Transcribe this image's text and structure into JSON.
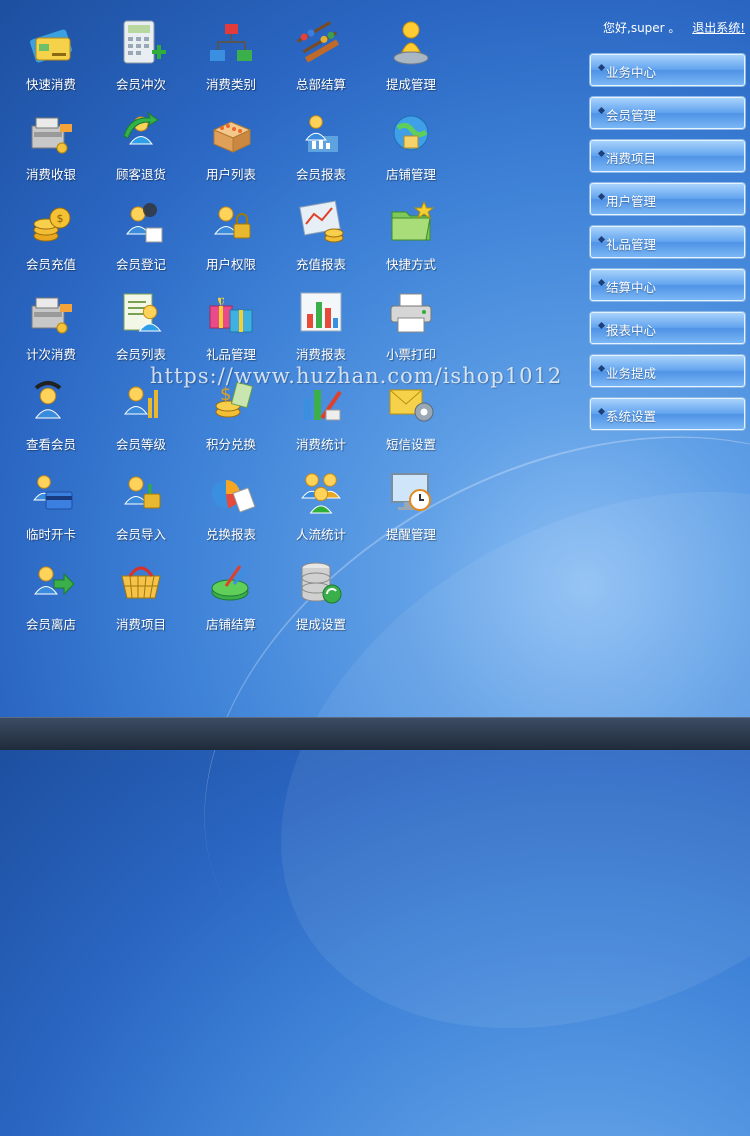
{
  "header": {
    "greeting": "您好,super 。",
    "logout_label": "退出系统!"
  },
  "icons": [
    {
      "label": "快速消费",
      "icon": "card-payment-icon"
    },
    {
      "label": "会员冲次",
      "icon": "calculator-plus-icon"
    },
    {
      "label": "消费类别",
      "icon": "category-tree-icon"
    },
    {
      "label": "总部结算",
      "icon": "abacus-icon"
    },
    {
      "label": "提成管理",
      "icon": "pawn-icon"
    },
    {
      "label": "消费收银",
      "icon": "cash-register-icon"
    },
    {
      "label": "顾客退货",
      "icon": "user-return-icon"
    },
    {
      "label": "用户列表",
      "icon": "box-grid-icon"
    },
    {
      "label": "会员报表",
      "icon": "member-report-icon"
    },
    {
      "label": "店铺管理",
      "icon": "store-globe-icon"
    },
    {
      "label": "会员充值",
      "icon": "coins-icon"
    },
    {
      "label": "会员登记",
      "icon": "user-register-icon"
    },
    {
      "label": "用户权限",
      "icon": "user-lock-icon"
    },
    {
      "label": "充值报表",
      "icon": "chart-coins-icon"
    },
    {
      "label": "快捷方式",
      "icon": "folder-star-icon"
    },
    {
      "label": "计次消费",
      "icon": "cash-register-icon"
    },
    {
      "label": "会员列表",
      "icon": "user-list-icon"
    },
    {
      "label": "礼品管理",
      "icon": "gift-icon"
    },
    {
      "label": "消费报表",
      "icon": "bar-chart-icon"
    },
    {
      "label": "小票打印",
      "icon": "printer-icon"
    },
    {
      "label": "查看会员",
      "icon": "user-view-icon"
    },
    {
      "label": "会员等级",
      "icon": "user-level-icon"
    },
    {
      "label": "积分兑换",
      "icon": "money-exchange-icon"
    },
    {
      "label": "消费统计",
      "icon": "stats-icon"
    },
    {
      "label": "短信设置",
      "icon": "mail-gear-icon"
    },
    {
      "label": "临时开卡",
      "icon": "temp-card-icon"
    },
    {
      "label": "会员导入",
      "icon": "user-import-icon"
    },
    {
      "label": "兑换报表",
      "icon": "pie-chart-icon"
    },
    {
      "label": "人流统计",
      "icon": "people-icon"
    },
    {
      "label": "提醒管理",
      "icon": "clock-monitor-icon"
    },
    {
      "label": "会员离店",
      "icon": "user-exit-icon"
    },
    {
      "label": "消费项目",
      "icon": "basket-icon"
    },
    {
      "label": "店铺结算",
      "icon": "settlement-icon"
    },
    {
      "label": "提成设置",
      "icon": "database-icon"
    }
  ],
  "sidebar": {
    "items": [
      {
        "label": "业务中心"
      },
      {
        "label": "会员管理"
      },
      {
        "label": "消费项目"
      },
      {
        "label": "用户管理"
      },
      {
        "label": "礼品管理"
      },
      {
        "label": "结算中心"
      },
      {
        "label": "报表中心"
      },
      {
        "label": "业务提成"
      },
      {
        "label": "系统设置"
      }
    ]
  },
  "watermark": "https://www.huzhan.com/ishop1012",
  "colors": {
    "background_center": "#8ec0f4",
    "background_edge": "#1d4f9f",
    "menu_button": "#62a4ef",
    "label_text": "#ffffff"
  }
}
